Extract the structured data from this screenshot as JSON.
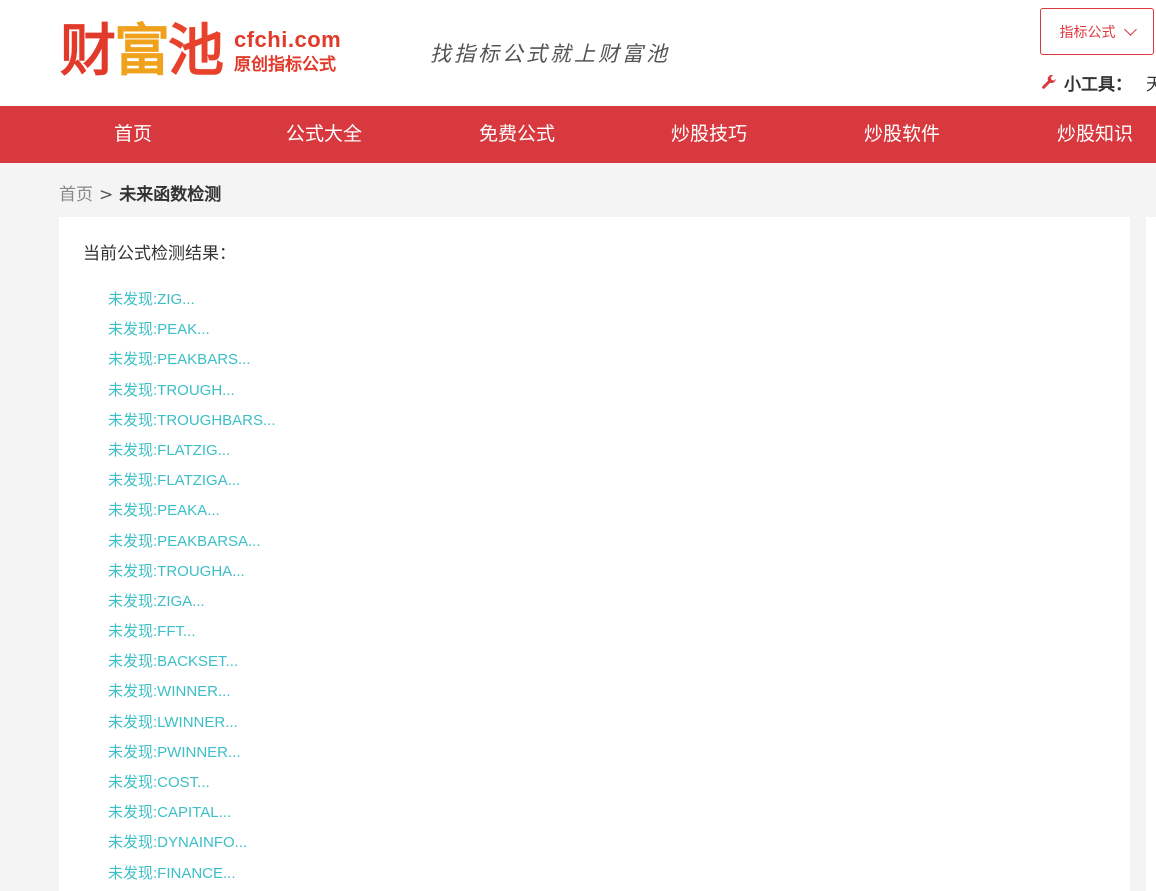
{
  "logo": {
    "chars": [
      "财",
      "富",
      "池"
    ],
    "domain": "cfchi.com",
    "subtitle": "原创指标公式"
  },
  "slogan": "找指标公式就上财富池",
  "dropdown": {
    "label": "指标公式",
    "icon": "chevron-down-icon"
  },
  "tools": {
    "icon": "wrench-icon",
    "label": "小工具：",
    "extra": "天"
  },
  "nav": {
    "items": [
      "首页",
      "公式大全",
      "免费公式",
      "炒股技巧",
      "炒股软件",
      "炒股知识"
    ]
  },
  "breadcrumb": {
    "home": "首页",
    "separator": ">",
    "current": "未来函数检测"
  },
  "result": {
    "title": "当前公式检测结果：",
    "items": [
      "未发现:ZIG...",
      "未发现:PEAK...",
      "未发现:PEAKBARS...",
      "未发现:TROUGH...",
      "未发现:TROUGHBARS...",
      "未发现:FLATZIG...",
      "未发现:FLATZIGA...",
      "未发现:PEAKA...",
      "未发现:PEAKBARSA...",
      "未发现:TROUGHA...",
      "未发现:ZIGA...",
      "未发现:FFT...",
      "未发现:BACKSET...",
      "未发现:WINNER...",
      "未发现:LWINNER...",
      "未发现:PWINNER...",
      "未发现:COST...",
      "未发现:CAPITAL...",
      "未发现:DYNAINFO...",
      "未发现:FINANCE..."
    ]
  },
  "colors": {
    "brand_red": "#d8393f",
    "link_teal": "#3cbfc6",
    "logo_orange": "#f0a21c"
  }
}
